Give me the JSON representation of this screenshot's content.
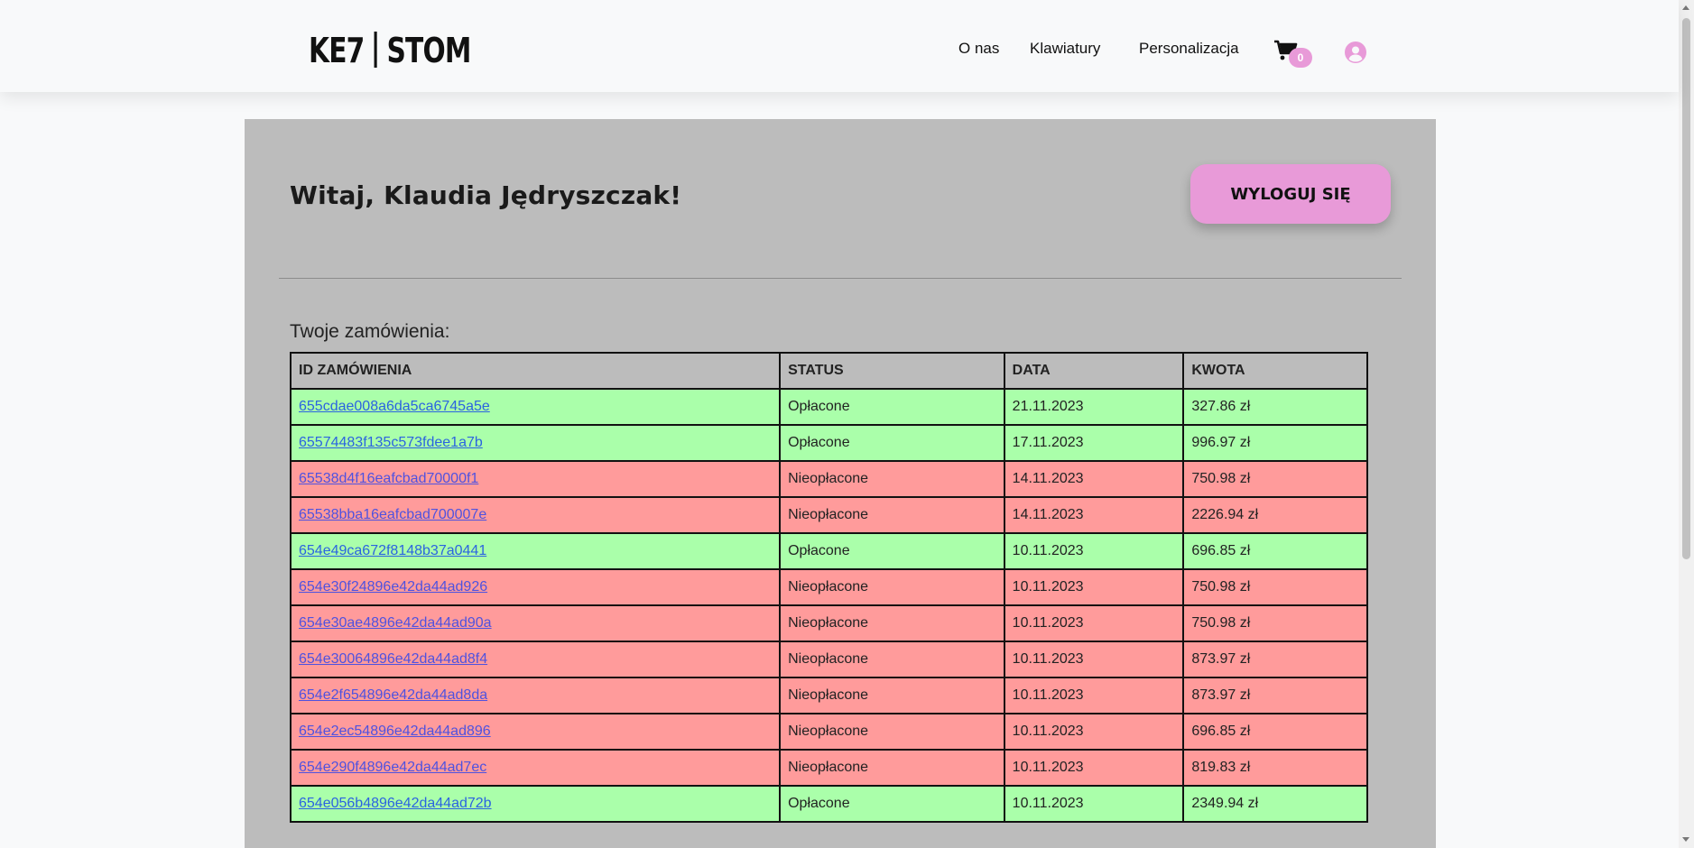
{
  "header": {
    "logo_left": "KE7",
    "logo_right": "STOM",
    "nav": [
      "O nas",
      "Klawiatury",
      "Personalizacja"
    ],
    "cart_count": "0"
  },
  "main": {
    "greeting": "Witaj, Klaudia Jędryszczak!",
    "logout_label": "WYLOGUJ SIĘ",
    "orders_label": "Twoje zamówienia:",
    "table": {
      "headers": [
        "ID ZAMÓWIENIA",
        "STATUS",
        "DATA",
        "KWOTA"
      ],
      "rows": [
        {
          "id": "655cdae008a6da5ca6745a5e",
          "status": "Opłacone",
          "date": "21.11.2023",
          "amount": "327.86 zł",
          "paid": true
        },
        {
          "id": "65574483f135c573fdee1a7b",
          "status": "Opłacone",
          "date": "17.11.2023",
          "amount": "996.97 zł",
          "paid": true
        },
        {
          "id": "65538d4f16eafcbad70000f1",
          "status": "Nieopłacone",
          "date": "14.11.2023",
          "amount": "750.98 zł",
          "paid": false
        },
        {
          "id": "65538bba16eafcbad700007e",
          "status": "Nieopłacone",
          "date": "14.11.2023",
          "amount": "2226.94 zł",
          "paid": false
        },
        {
          "id": "654e49ca672f8148b37a0441",
          "status": "Opłacone",
          "date": "10.11.2023",
          "amount": "696.85 zł",
          "paid": true
        },
        {
          "id": "654e30f24896e42da44ad926",
          "status": "Nieopłacone",
          "date": "10.11.2023",
          "amount": "750.98 zł",
          "paid": false
        },
        {
          "id": "654e30ae4896e42da44ad90a",
          "status": "Nieopłacone",
          "date": "10.11.2023",
          "amount": "750.98 zł",
          "paid": false
        },
        {
          "id": "654e30064896e42da44ad8f4",
          "status": "Nieopłacone",
          "date": "10.11.2023",
          "amount": "873.97 zł",
          "paid": false
        },
        {
          "id": "654e2f654896e42da44ad8da",
          "status": "Nieopłacone",
          "date": "10.11.2023",
          "amount": "873.97 zł",
          "paid": false
        },
        {
          "id": "654e2ec54896e42da44ad896",
          "status": "Nieopłacone",
          "date": "10.11.2023",
          "amount": "696.85 zł",
          "paid": false
        },
        {
          "id": "654e290f4896e42da44ad7ec",
          "status": "Nieopłacone",
          "date": "10.11.2023",
          "amount": "819.83 zł",
          "paid": false
        },
        {
          "id": "654e056b4896e42da44ad72b",
          "status": "Opłacone",
          "date": "10.11.2023",
          "amount": "2349.94 zł",
          "paid": true
        }
      ]
    }
  },
  "colors": {
    "accent": "#e89ad8",
    "paid_row": "#aaffaa",
    "unpaid_row": "#ff9b9b",
    "panel": "#bcbcbc"
  }
}
